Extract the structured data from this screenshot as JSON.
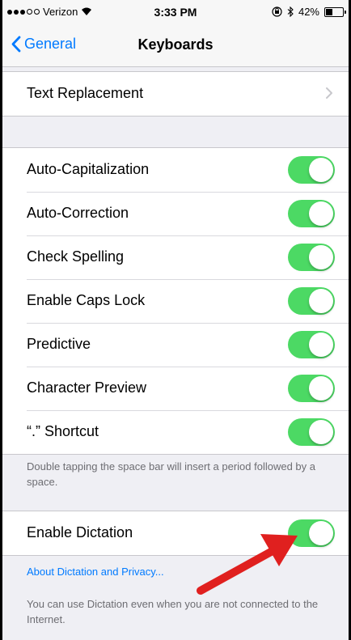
{
  "status_bar": {
    "carrier": "Verizon",
    "time": "3:33 PM",
    "battery": "42%",
    "battery_level": 0.42
  },
  "nav": {
    "back_label": "General",
    "title": "Keyboards"
  },
  "group1": {
    "rows": [
      {
        "label": "Text Replacement"
      }
    ]
  },
  "group2": {
    "rows": [
      {
        "label": "Auto-Capitalization",
        "on": true
      },
      {
        "label": "Auto-Correction",
        "on": true
      },
      {
        "label": "Check Spelling",
        "on": true
      },
      {
        "label": "Enable Caps Lock",
        "on": true
      },
      {
        "label": "Predictive",
        "on": true
      },
      {
        "label": "Character Preview",
        "on": true
      },
      {
        "label": "“.” Shortcut",
        "on": true
      }
    ],
    "footer": "Double tapping the space bar will insert a period followed by a space."
  },
  "group3": {
    "rows": [
      {
        "label": "Enable Dictation",
        "on": true
      }
    ],
    "link": "About Dictation and Privacy...",
    "footer": "You can use Dictation even when you are not connected to the Internet."
  },
  "colors": {
    "accent": "#007aff",
    "toggle_on": "#4cd964",
    "annotation_arrow": "#e0201f"
  }
}
